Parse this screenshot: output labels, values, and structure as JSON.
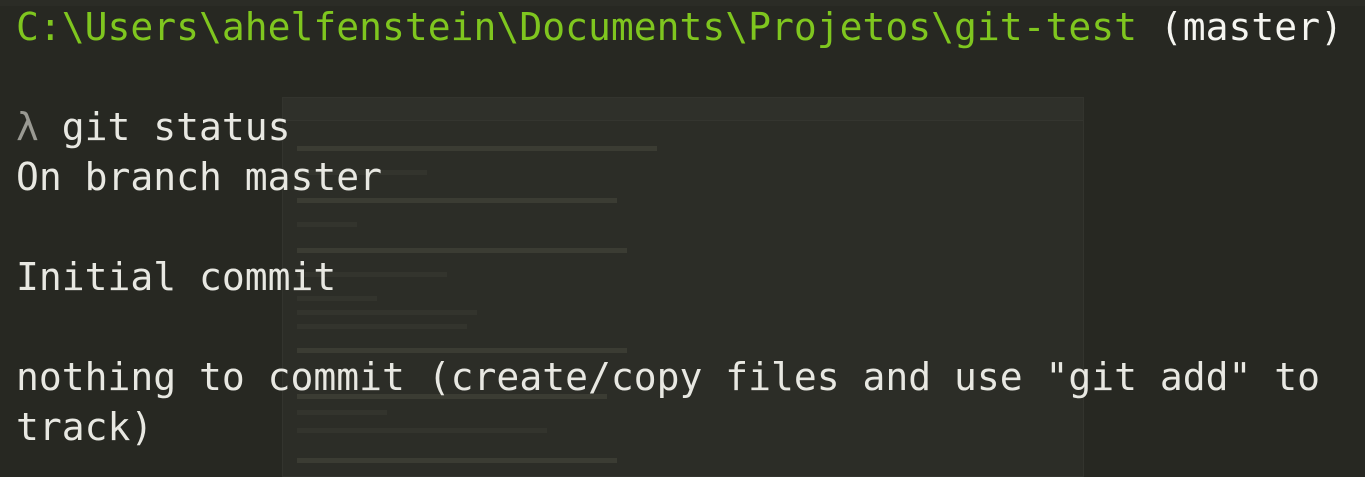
{
  "prompt": {
    "path": "C:\\Users\\ahelfenstein\\Documents\\Projetos\\git-test",
    "branch": "(master)",
    "symbol": "λ"
  },
  "command": "git status",
  "output": {
    "line1": "On branch master",
    "line2": "Initial commit",
    "line3a": "nothing to commit (create/copy files and use \"git add\" to",
    "line3b": "track)"
  },
  "colors": {
    "background": "#272822",
    "path": "#7fc61f",
    "text": "#e8e8e2",
    "lambda": "#9a9a93"
  }
}
